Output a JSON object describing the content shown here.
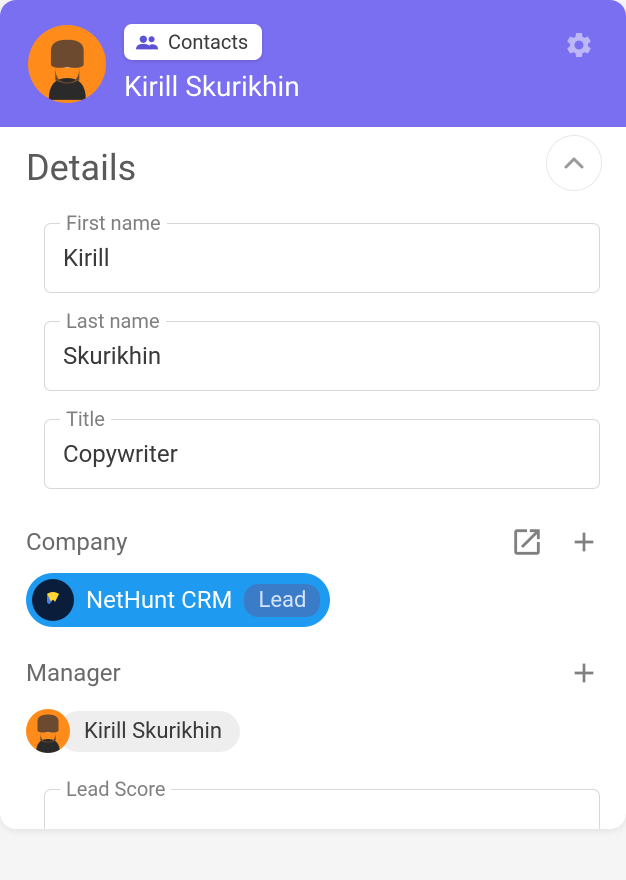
{
  "header": {
    "badge_label": "Contacts",
    "contact_name": "Kirill Skurikhin"
  },
  "details": {
    "section_title": "Details",
    "first_name": {
      "label": "First name",
      "value": "Kirill"
    },
    "last_name": {
      "label": "Last name",
      "value": "Skurikhin"
    },
    "title": {
      "label": "Title",
      "value": "Copywriter"
    },
    "company": {
      "label": "Company",
      "name": "NetHunt CRM",
      "status": "Lead"
    },
    "manager": {
      "label": "Manager",
      "name": "Kirill Skurikhin"
    },
    "lead_score": {
      "label": "Lead Score"
    }
  }
}
